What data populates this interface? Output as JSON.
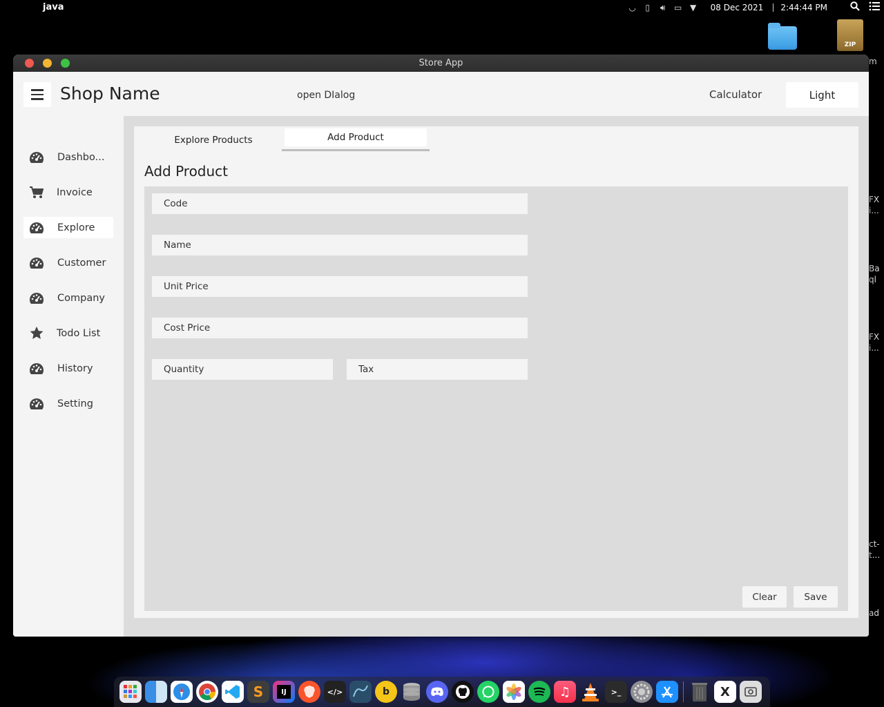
{
  "menubar": {
    "app_name": "java",
    "date": "08 Dec 2021",
    "time": "2:44:44 PM"
  },
  "desktop": {
    "zip_label": "ZIP",
    "edge_texts": [
      "m",
      "FX",
      "i...",
      "Ba",
      "ql",
      "FX",
      "i...",
      "ct-",
      "t...",
      "ad"
    ]
  },
  "window": {
    "title": "Store App"
  },
  "header": {
    "shop_name": "Shop Name",
    "open_dialog": "open DIalog",
    "calculator": "Calculator",
    "theme_button": "Light"
  },
  "sidebar": {
    "items": [
      {
        "label": "Dashbo...",
        "icon": "dashboard-icon"
      },
      {
        "label": "Invoice",
        "icon": "cart-icon"
      },
      {
        "label": "Explore",
        "icon": "dashboard-icon"
      },
      {
        "label": "Customer",
        "icon": "dashboard-icon"
      },
      {
        "label": "Company",
        "icon": "dashboard-icon"
      },
      {
        "label": "Todo List",
        "icon": "star-icon"
      },
      {
        "label": "History",
        "icon": "dashboard-icon"
      },
      {
        "label": "Setting",
        "icon": "dashboard-icon"
      }
    ],
    "active": "Explore"
  },
  "tabs": {
    "explore": "Explore Products",
    "add": "Add Product",
    "active": "Add Product"
  },
  "form": {
    "title": "Add Product",
    "code_placeholder": "Code",
    "name_placeholder": "Name",
    "unit_price_placeholder": "Unit Price",
    "cost_price_placeholder": "Cost Price",
    "quantity_placeholder": "Quantity",
    "tax_placeholder": "Tax",
    "clear": "Clear",
    "save": "Save"
  },
  "dock": {
    "apps": [
      "launchpad",
      "finder",
      "safari",
      "chrome",
      "vscode",
      "sublime-text",
      "intellij",
      "brave",
      "terminal-dev",
      "mysql-workbench",
      "bit",
      "database",
      "discord",
      "github",
      "whatsapp",
      "photos",
      "spotify",
      "music",
      "vlc",
      "terminal",
      "system-preferences",
      "app-store",
      "trash",
      "xquartz",
      "screenshot"
    ]
  },
  "colors": {
    "window_bg": "#f4f4f4",
    "content_bg": "#dcdcdc",
    "field_bg": "#f4f4f4",
    "traffic_close": "#ee5a50",
    "traffic_min": "#f3b632",
    "traffic_max": "#3ec244"
  }
}
